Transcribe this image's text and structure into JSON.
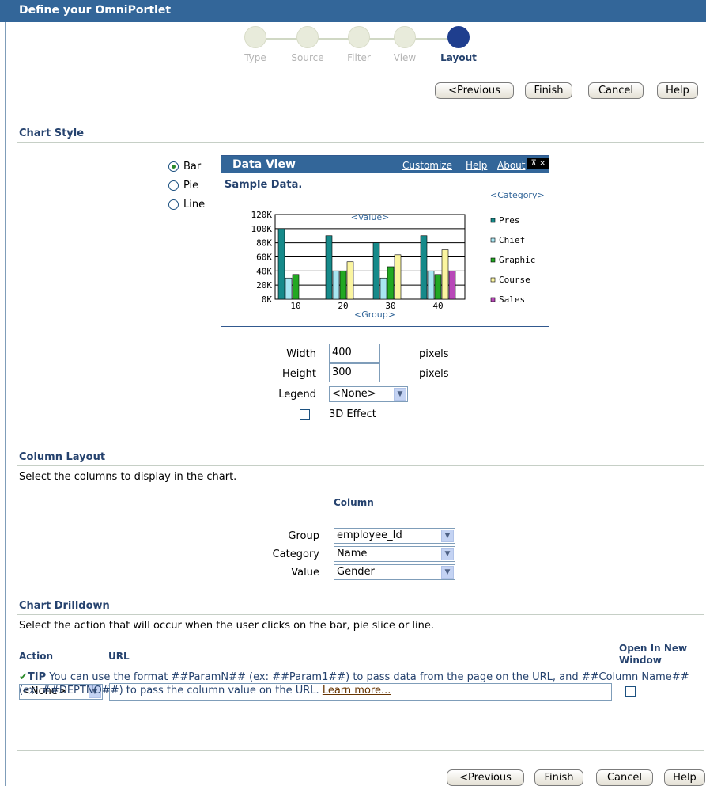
{
  "header": {
    "title": "Define your OmniPortlet"
  },
  "train": {
    "steps": [
      {
        "label": "Type",
        "active": false
      },
      {
        "label": "Source",
        "active": false
      },
      {
        "label": "Filter",
        "active": false
      },
      {
        "label": "View",
        "active": false
      },
      {
        "label": "Layout",
        "active": true
      }
    ]
  },
  "buttons": {
    "previous": "<Previous",
    "finish": "Finish",
    "cancel": "Cancel",
    "help": "Help"
  },
  "chart_style": {
    "heading": "Chart Style",
    "types": [
      "Bar",
      "Pie",
      "Line"
    ],
    "selected": "Bar",
    "preview": {
      "title": "Data View",
      "links": [
        "Customize",
        "Help",
        "About"
      ],
      "subtitle": "Sample Data.",
      "category_placeholder": "<Category>",
      "value_placeholder": "<Value>",
      "group_placeholder": "<Group>"
    },
    "width_label": "Width",
    "width_value": "400",
    "width_unit": "pixels",
    "height_label": "Height",
    "height_value": "300",
    "height_unit": "pixels",
    "legend_label": "Legend",
    "legend_value": "<None>",
    "effect_label": "3D Effect"
  },
  "chart_data": {
    "type": "bar",
    "categories": [
      "10",
      "20",
      "30",
      "40"
    ],
    "ylim": [
      0,
      120000
    ],
    "yticks": [
      "0K",
      "20K",
      "40K",
      "60K",
      "80K",
      "100K",
      "120K"
    ],
    "series": [
      {
        "name": "Pres",
        "color": "#168a8a",
        "values": [
          100000,
          90000,
          80000,
          90000
        ]
      },
      {
        "name": "Chief",
        "color": "#a8e6f2",
        "values": [
          30000,
          40000,
          30000,
          40000
        ]
      },
      {
        "name": "Graphic",
        "color": "#22a822",
        "values": [
          35000,
          40000,
          46000,
          35000
        ]
      },
      {
        "name": "Course",
        "color": "#fbf5a0",
        "values": [
          0,
          53000,
          63000,
          70000
        ]
      },
      {
        "name": "Sales",
        "color": "#b848b8",
        "values": [
          0,
          0,
          0,
          40000
        ]
      }
    ],
    "grid": true,
    "legend": "right"
  },
  "column_layout": {
    "heading": "Column Layout",
    "instruction": "Select the columns to display in the chart.",
    "column_header": "Column",
    "rows": [
      {
        "label": "Group",
        "value": "employee_Id"
      },
      {
        "label": "Category",
        "value": "Name"
      },
      {
        "label": "Value",
        "value": "Gender"
      }
    ]
  },
  "drilldown": {
    "heading": "Chart Drilldown",
    "instruction": "Select the action that will occur when the user clicks on the bar, pie slice or line.",
    "action_header": "Action",
    "url_header": "URL",
    "newwin_header_1": "Open In New",
    "newwin_header_2": "Window",
    "action_value": "<None>",
    "url_value": "",
    "tip_label": "TIP",
    "tip_text": "You can use the format ##ParamN## (ex: ##Param1##) to pass data from the page on the URL, and ##Column Name## (ex: ##DEPTNO##) to pass the column value on the URL.",
    "learn_more": "Learn more..."
  }
}
